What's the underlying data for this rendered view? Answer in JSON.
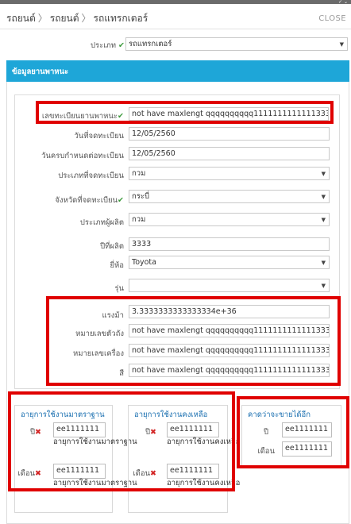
{
  "header": {
    "breadcrumb": [
      "รถยนต์",
      "รถยนต์",
      "รถแทรกเตอร์"
    ],
    "close_label": "CLOSE"
  },
  "type_field": {
    "label": "ประเภท",
    "value": "รถแทรกเตอร์"
  },
  "section_title": "ข้อมูลยานพาหนะ",
  "vehicle_form": {
    "plate": {
      "label": "เลขทะเบียนยานพาหนะ",
      "value": "not have maxlengt qqqqqqqqqq1111111111111333"
    },
    "reg_date": {
      "label": "วันที่จดทะเบียน",
      "value": "12/05/2560"
    },
    "due_date": {
      "label": "วันครบกำหนดต่อทะเบียน",
      "value": "12/05/2560"
    },
    "reg_type": {
      "label": "ประเภทที่จดทะเบียน",
      "value": "กวม"
    },
    "province": {
      "label": "จังหวัดที่จดทะเบียน",
      "value": "กระบี่"
    },
    "maker_type": {
      "label": "ประเภทผู้ผลิต",
      "value": "กวม"
    },
    "year": {
      "label": "ปีที่ผลิต",
      "value": "3333"
    },
    "brand": {
      "label": "ยี่ห้อ",
      "value": "Toyota"
    },
    "model": {
      "label": "รุ่น",
      "value": ""
    },
    "horsepower": {
      "label": "แรงม้า",
      "value": "3.3333333333333334e+36"
    },
    "chassis": {
      "label": "หมายเลขตัวถัง",
      "value": "not have maxlengt qqqqqqqqqq1111111111111333"
    },
    "engine": {
      "label": "หมายเลขเครื่อง",
      "value": "not have maxlengt qqqqqqqqqq1111111111111333"
    },
    "color": {
      "label": "สี",
      "value": "not have maxlengt qqqqqqqqqq1111111111111333"
    }
  },
  "standard_life": {
    "title": "อายุการใช้งานมาตราฐาน",
    "year_label": "ปี",
    "year_value": "ee1111111",
    "year_hint": "อายุการใช้งานมาตราฐาน",
    "month_label": "เดือน",
    "month_value": "ee1111111",
    "month_hint": "อายุการใช้งานมาตราฐาน"
  },
  "remaining_life": {
    "title": "อายุการใช้งานคงเหลือ",
    "year_label": "ปี",
    "year_value": "ee1111111",
    "year_hint": "อายุการใช้งานคงเหลือ",
    "month_label": "เดือน",
    "month_value": "ee1111111",
    "month_hint": "อายุการใช้งานคงเหลือ"
  },
  "sell_estimate": {
    "title": "คาดว่าจะขายได้อีก",
    "year_label": "ปี",
    "year_value": "ee1111111",
    "month_label": "เดือน",
    "month_value": "ee1111111"
  },
  "colors": {
    "accent": "#1ea6d8",
    "highlight": "#e00000",
    "ok": "#3c9a3c"
  }
}
